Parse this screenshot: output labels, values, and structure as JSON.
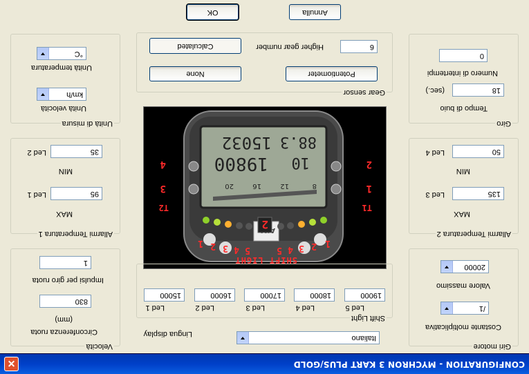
{
  "window": {
    "title": "CONFIGURATION - MYCHRON 3 KART PLUS/GOLD",
    "close_label": "✕"
  },
  "actions": {
    "ok": "OK",
    "cancel": "Annulla"
  },
  "unita_misura": {
    "legend": "Unità di misura",
    "temp_label": "Unità temperatura",
    "temp_value": "°C",
    "vel_label": "Unità velocità",
    "vel_value": "km/h"
  },
  "gear_sensor": {
    "legend": "Gear sensor",
    "calculated": "Calculated",
    "higher_gear_label": "Higher gear number",
    "higher_gear_value": "6",
    "none": "None",
    "potentiometer": "Potentiometer"
  },
  "giro": {
    "legend": "Giro",
    "intertempi_label": "Numero di intertempi",
    "intertempi_value": "0",
    "buio_label": "Tempo di buio",
    "buio_unit": "(sec.)",
    "buio_value": "18"
  },
  "allarmi1": {
    "legend": "Allarmi Temperatura 1",
    "max_label": "MAX",
    "min_label": "MIN",
    "led1_label": "Led 1",
    "led1_value": "95",
    "led2_label": "Led 2",
    "led2_value": "35"
  },
  "allarmi2": {
    "legend": "Allarmi Temperatura 2",
    "max_label": "MAX",
    "min_label": "MIN",
    "led3_label": "Led 3",
    "led3_value": "135",
    "led4_label": "Led 4",
    "led4_value": "50"
  },
  "velocita": {
    "legend": "Velocità",
    "impulsi_label": "Impulsi per giro ruota",
    "impulsi_value": "1",
    "circ_label": "Circonferenza ruota",
    "circ_unit": "(mm)",
    "circ_value": "830"
  },
  "shift_light": {
    "legend": "Shift Light",
    "leds": [
      {
        "label": "Led 1",
        "value": "15000"
      },
      {
        "label": "Led 2",
        "value": "16000"
      },
      {
        "label": "Led 3",
        "value": "17000"
      },
      {
        "label": "Led 4",
        "value": "18000"
      },
      {
        "label": "Led 5",
        "value": "19000"
      }
    ]
  },
  "giri_motore": {
    "legend": "Giri motore",
    "max_label": "Valore massimo",
    "max_value": "20000",
    "coef_label": "Costante moltiplicativa",
    "coef_value": "/1"
  },
  "display": {
    "lingua_label": "Lingua display",
    "lingua_value": "Italiano"
  },
  "device": {
    "lcd_top_left": "88.3",
    "lcd_top_right": "15032",
    "lcd_mid_left": "10",
    "lcd_mid_right": "19800",
    "lcd_scale": [
      "8",
      "12",
      "16",
      "20"
    ],
    "logo": "AIM",
    "gear": "2",
    "shift_label": "SHIFT LIGHT",
    "led_numbers_left": [
      "1",
      "2",
      "3",
      "4",
      "5"
    ],
    "led_numbers_right": [
      "5",
      "4",
      "3",
      "2",
      "1"
    ],
    "side_left": [
      "2",
      "1",
      "T1"
    ],
    "side_right": [
      "4",
      "3",
      "T2"
    ]
  }
}
